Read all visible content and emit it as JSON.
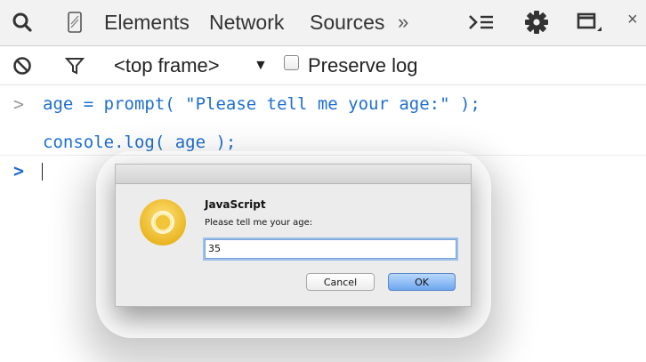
{
  "toolbar": {
    "tabs": [
      "Elements",
      "Network",
      "Sources"
    ],
    "more_glyph": "»",
    "close_glyph": "×",
    "icons": [
      "search-icon",
      "device-mode-icon",
      "console-drawer-icon",
      "gear-icon",
      "dock-icon",
      "close-icon"
    ]
  },
  "filter_bar": {
    "frame_selector": "<top frame>",
    "dropdown_glyph": "▼",
    "preserve_log_label": "Preserve log",
    "preserve_log_checked": false,
    "icons": [
      "clear-console-icon",
      "filter-icon"
    ]
  },
  "console": {
    "lines": [
      {
        "prefix": ">",
        "text": "age = prompt( \"Please tell me your age:\" );"
      },
      {
        "prefix": "",
        "text": "console.log( age );"
      }
    ],
    "input_prompt": ">",
    "colors": {
      "code": "#1e6ecf",
      "prompt_active": "#1e6ecf",
      "prompt_history": "#9a9a9a"
    }
  },
  "dialog": {
    "title": "JavaScript",
    "message": "Please tell me your age:",
    "input_value": "35",
    "cancel_label": "Cancel",
    "ok_label": "OK",
    "icon": "chrome-logo-icon",
    "colors": {
      "ok_button": "#6ea6f0",
      "focus_ring": "#9cc0ea"
    }
  }
}
